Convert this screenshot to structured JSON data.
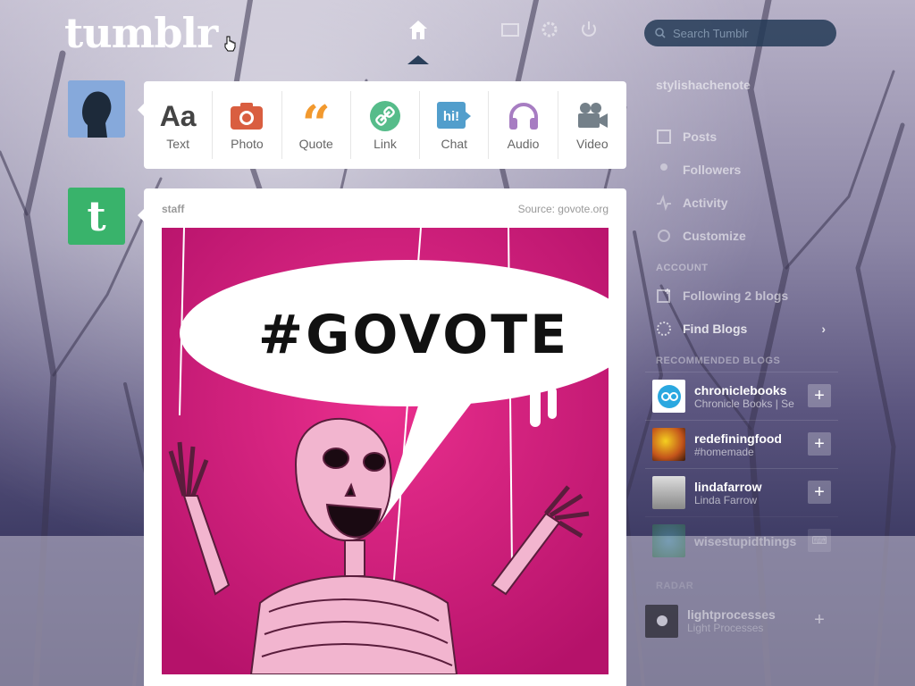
{
  "app": {
    "logo": "tumblr"
  },
  "search": {
    "placeholder": "Search Tumblr"
  },
  "post_types": [
    {
      "label": "Text",
      "icon": "text-icon",
      "color": "#444444"
    },
    {
      "label": "Photo",
      "icon": "camera-icon",
      "color": "#d95e40"
    },
    {
      "label": "Quote",
      "icon": "quote-icon",
      "color": "#f2992e"
    },
    {
      "label": "Link",
      "icon": "link-icon",
      "color": "#56bc8a"
    },
    {
      "label": "Chat",
      "icon": "chat-icon",
      "color": "#529ecc"
    },
    {
      "label": "Audio",
      "icon": "headphones-icon",
      "color": "#a77dc2"
    },
    {
      "label": "Video",
      "icon": "video-camera-icon",
      "color": "#748089"
    }
  ],
  "post": {
    "author": "staff",
    "source": "Source: govote.org",
    "image_text": "#GOVOTE"
  },
  "sidebar": {
    "blog_title": "stylishachenote",
    "items": [
      {
        "label": "Posts",
        "icon": "posts-icon"
      },
      {
        "label": "Followers",
        "icon": "followers-icon"
      },
      {
        "label": "Activity",
        "icon": "activity-icon"
      },
      {
        "label": "Customize",
        "icon": "customize-icon"
      }
    ],
    "account_header": "ACCOUNT",
    "account_items": [
      {
        "label": "Following 2 blogs",
        "icon": "following-icon"
      },
      {
        "label": "Find Blogs",
        "icon": "compass-icon"
      }
    ],
    "recommended_header": "RECOMMENDED BLOGS",
    "recommended": [
      {
        "name": "chroniclebooks",
        "sub": "Chronicle Books | Se",
        "avatar_color": "#2aa8e0"
      },
      {
        "name": "redefiningfood",
        "sub": "#homemade",
        "avatar_color": "#e0c020"
      },
      {
        "name": "lindafarrow",
        "sub": "Linda Farrow",
        "avatar_color": "#cccccc"
      },
      {
        "name": "wisestupidthings",
        "sub": "",
        "avatar_color": "#2f8a4a"
      }
    ],
    "radar_header": "RADAR",
    "radar": {
      "name": "lightprocesses",
      "sub": "Light Processes"
    }
  },
  "colors": {
    "accent": "#36465d",
    "staff_green": "#39b36b"
  }
}
